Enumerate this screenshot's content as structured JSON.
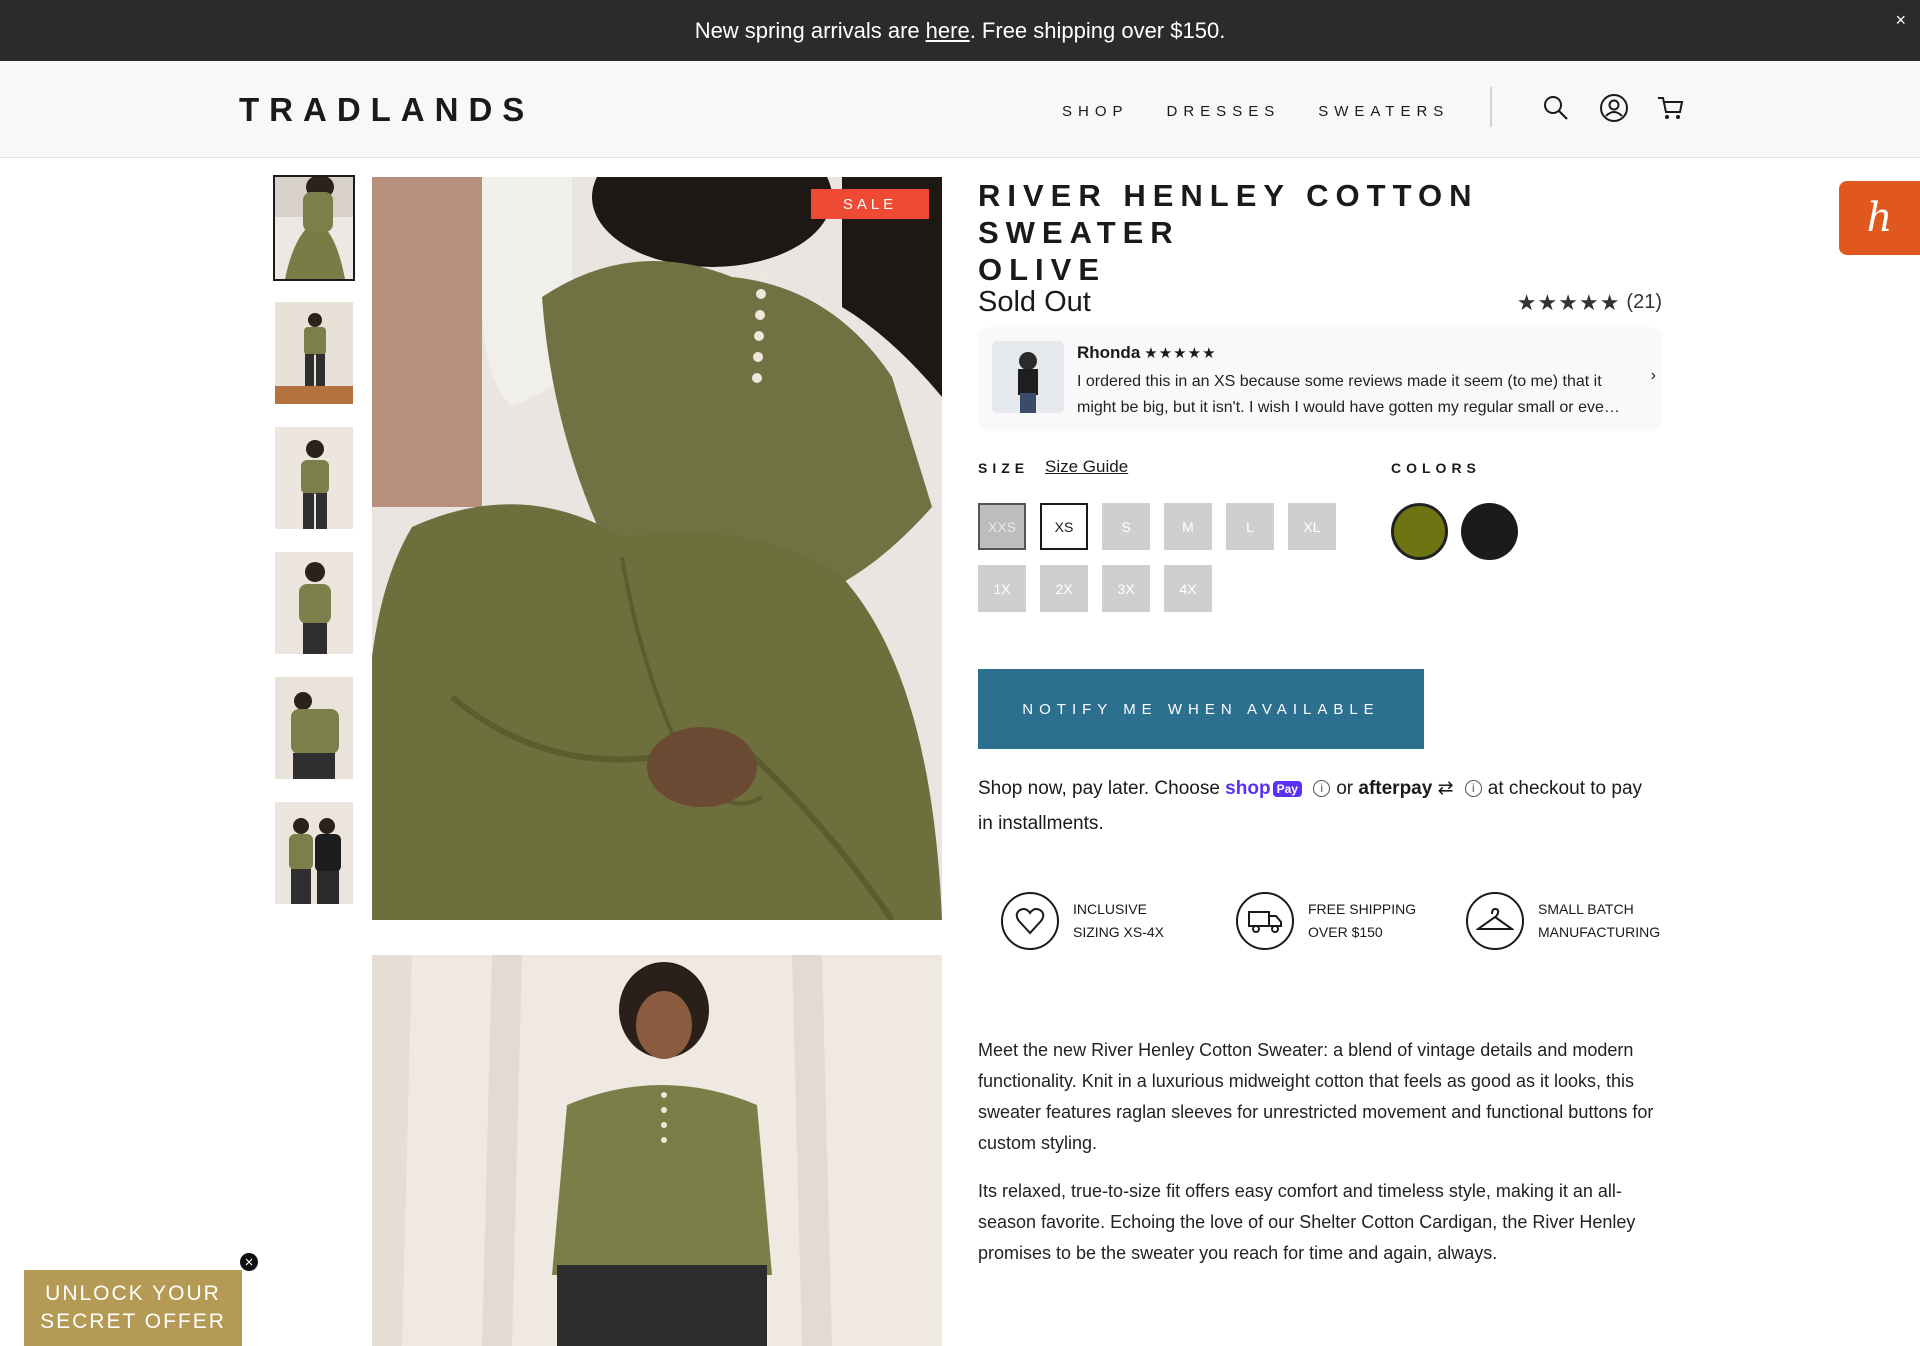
{
  "announcement": {
    "text_before": "New spring arrivals are",
    "link": "here",
    "text_after": ". Free shipping over $150.",
    "close": "×"
  },
  "header": {
    "logo": "TRADLANDS",
    "nav": [
      "SHOP",
      "DRESSES",
      "SWEATERS"
    ],
    "icons": [
      "search-icon",
      "account-icon",
      "cart-icon"
    ]
  },
  "gallery": {
    "sale_badge": "SALE",
    "thumbnail_count": 6
  },
  "product": {
    "title_line1": "RIVER HENLEY COTTON SWEATER",
    "title_line2": "OLIVE",
    "price": "Sold Out",
    "rating_stars": "★★★★★",
    "rating_count": "(21)"
  },
  "review": {
    "name": "Rhonda",
    "stars": "★★★★★",
    "text": "I ordered this in an XS because some reviews made it seem (to me) that it might be big, but it isn't. I wish I would have gotten my regular small or eve…",
    "next": "›"
  },
  "size": {
    "label": "SIZE",
    "guide": "Size Guide",
    "options": [
      "XXS",
      "XS",
      "S",
      "M",
      "L",
      "XL",
      "1X",
      "2X",
      "3X",
      "4X"
    ],
    "selected": "XS"
  },
  "colors": {
    "label": "COLORS",
    "swatches": [
      "#6f7413",
      "#1b1b1b"
    ],
    "selected": "#6f7413"
  },
  "notify_button": "NOTIFY ME WHEN AVAILABLE",
  "paylater": {
    "before": "Shop now, pay later. Choose",
    "shop": "shop",
    "pay": "Pay",
    "or": "or",
    "afterpay": "afterpay",
    "after": "at checkout to pay in installments.",
    "info": "i"
  },
  "perks": [
    {
      "icon": "heart-icon",
      "line1": "INCLUSIVE",
      "line2": "SIZING XS-4X"
    },
    {
      "icon": "truck-icon",
      "line1": "FREE SHIPPING",
      "line2": "OVER $150"
    },
    {
      "icon": "hanger-icon",
      "line1": "SMALL BATCH",
      "line2": "MANUFACTURING"
    }
  ],
  "description": {
    "p1": "Meet the new River Henley Cotton Sweater: a blend of vintage details and modern functionality. Knit in a luxurious midweight cotton that feels as good as it looks, this sweater features raglan sleeves for unrestricted movement and functional buttons for custom styling.",
    "p2": "Its relaxed, true-to-size fit offers easy comfort and timeless style, making it an all-season favorite. Echoing the love of our Shelter Cotton Cardigan, the River Henley promises to be the sweater you reach for time and again, always."
  },
  "honey": "h",
  "secret_offer": {
    "line1": "UNLOCK YOUR",
    "line2": "SECRET OFFER",
    "close": "×"
  },
  "colors_theme": {
    "announcement_bg": "#2b2b2b",
    "sale": "#ef4a33",
    "notify": "#2c6f8f",
    "honey": "#e1581e",
    "secret": "#b49a54"
  }
}
